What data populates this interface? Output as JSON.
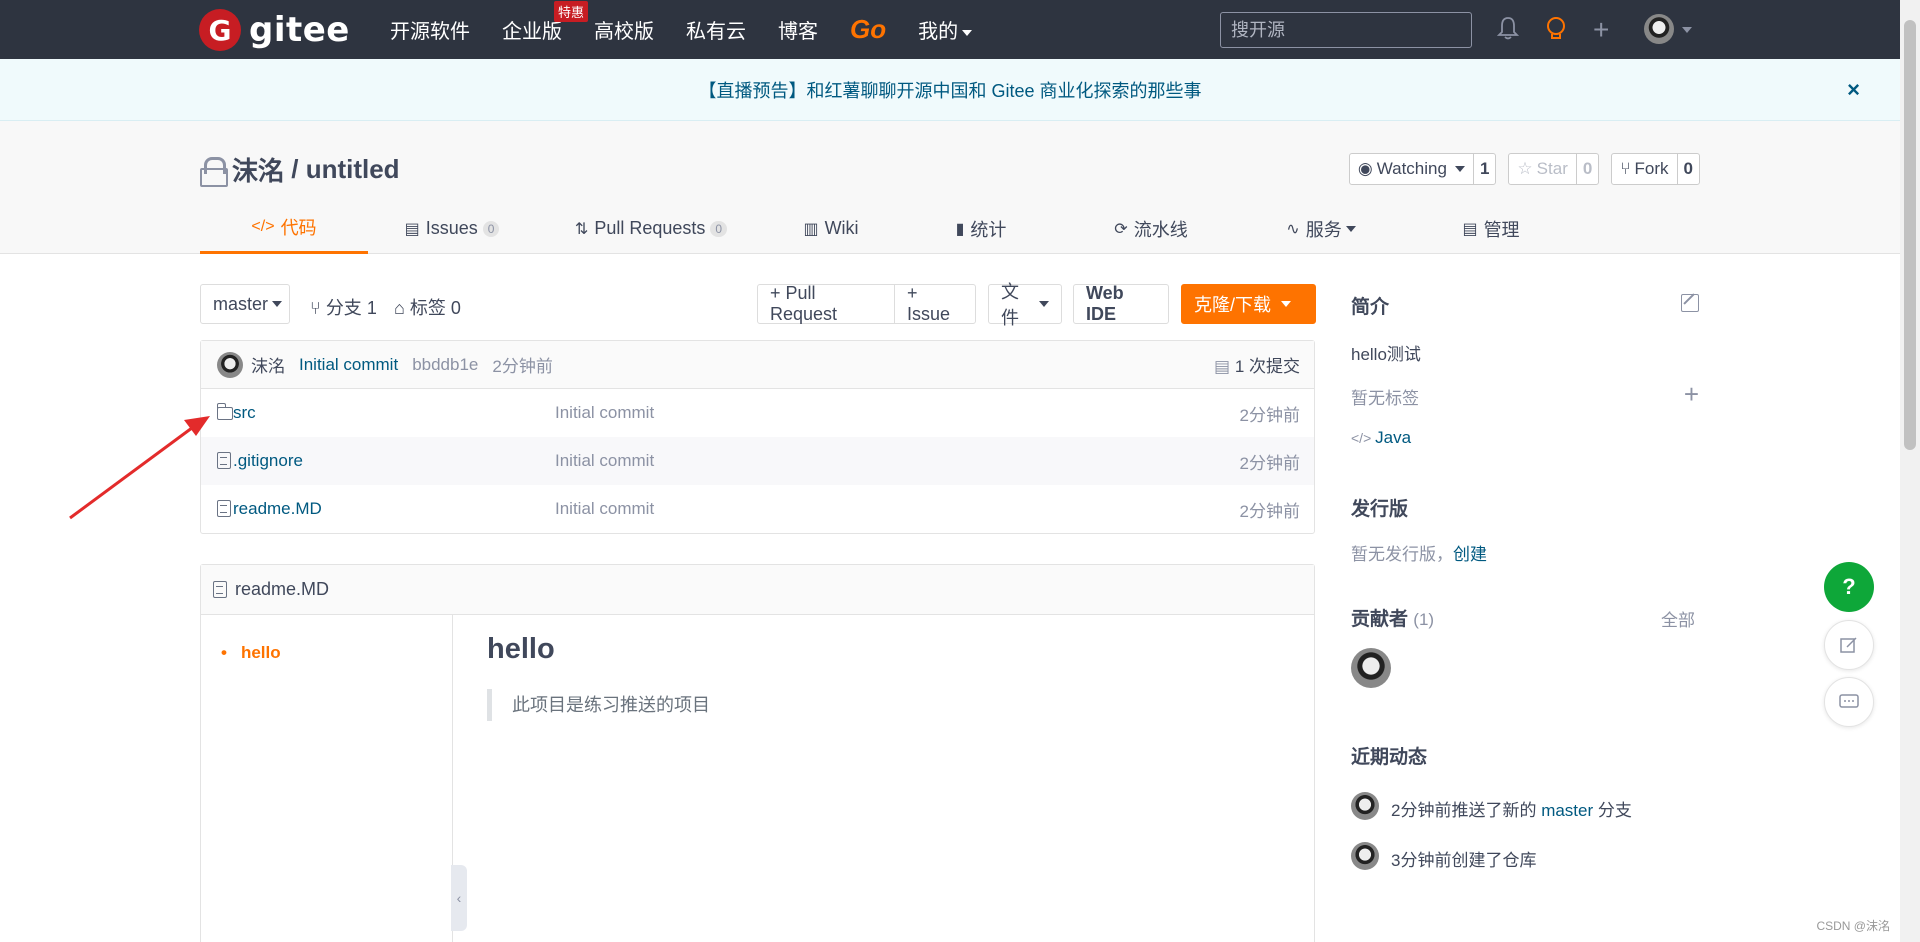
{
  "nav": {
    "logo_glyph": "G",
    "logo_text": "gitee",
    "items": [
      "开源软件",
      "企业版",
      "高校版",
      "私有云",
      "博客",
      "Go",
      "我的"
    ],
    "badge": "特惠",
    "search_placeholder": "搜开源"
  },
  "banner": {
    "text": "【直播预告】和红薯聊聊开源中国和 Gitee 商业化探索的那些事",
    "close": "×"
  },
  "repo": {
    "owner": "沫洺",
    "sep": " / ",
    "name": "untitled",
    "watching_label": "Watching",
    "watching_count": "1",
    "star_label": "Star",
    "star_count": "0",
    "fork_label": "Fork",
    "fork_count": "0"
  },
  "tabs": [
    {
      "icon": "</>",
      "label": "代码"
    },
    {
      "icon": "▤",
      "label": "Issues",
      "count": "0"
    },
    {
      "icon": "⇅",
      "label": "Pull Requests",
      "count": "0"
    },
    {
      "icon": "▥",
      "label": "Wiki"
    },
    {
      "icon": "▮",
      "label": "统计"
    },
    {
      "icon": "⟳",
      "label": "流水线"
    },
    {
      "icon": "∿",
      "label": "服务"
    },
    {
      "icon": "▤",
      "label": "管理"
    }
  ],
  "toolbar": {
    "branch": "master",
    "branches": "分支 1",
    "tags": "标签 0",
    "pull_request": "+ Pull Request",
    "issue": "+ Issue",
    "file": "文件",
    "web_ide": "Web IDE",
    "clone": "克隆/下载"
  },
  "commit": {
    "author": "沫洺",
    "message": "Initial commit",
    "sha": "bbddb1e",
    "ago": "2分钟前",
    "count": "1 次提交"
  },
  "files": [
    {
      "type": "folder",
      "name": "src",
      "message": "Initial commit",
      "ago": "2分钟前"
    },
    {
      "type": "file",
      "name": ".gitignore",
      "message": "Initial commit",
      "ago": "2分钟前"
    },
    {
      "type": "file",
      "name": "readme.MD",
      "message": "Initial commit",
      "ago": "2分钟前"
    }
  ],
  "readme": {
    "filename": "readme.MD",
    "toc_item": "hello",
    "heading": "hello",
    "quote": "此项目是练习推送的项目",
    "toggle": "‹"
  },
  "sidebar": {
    "intro_title": "简介",
    "intro_text": "hello测试",
    "no_tags": "暂无标签",
    "language": "Java",
    "release_title": "发行版",
    "no_release": "暂无发行版，",
    "create": "创建",
    "contributors_title": "贡献者",
    "contributors_count": "(1)",
    "all": "全部",
    "activity_title": "近期动态",
    "activity": [
      {
        "pre": "2分钟前推送了新的 ",
        "link": "master",
        "post": " 分支"
      },
      {
        "pre": "3分钟前创建了仓库",
        "link": "",
        "post": ""
      }
    ]
  },
  "fab_help": "?",
  "watermark": "CSDN @沫洺",
  "colors": {
    "accent": "#fe7300",
    "nav_bg": "#2e3440",
    "link": "#005980",
    "brand": "#c71d23"
  }
}
